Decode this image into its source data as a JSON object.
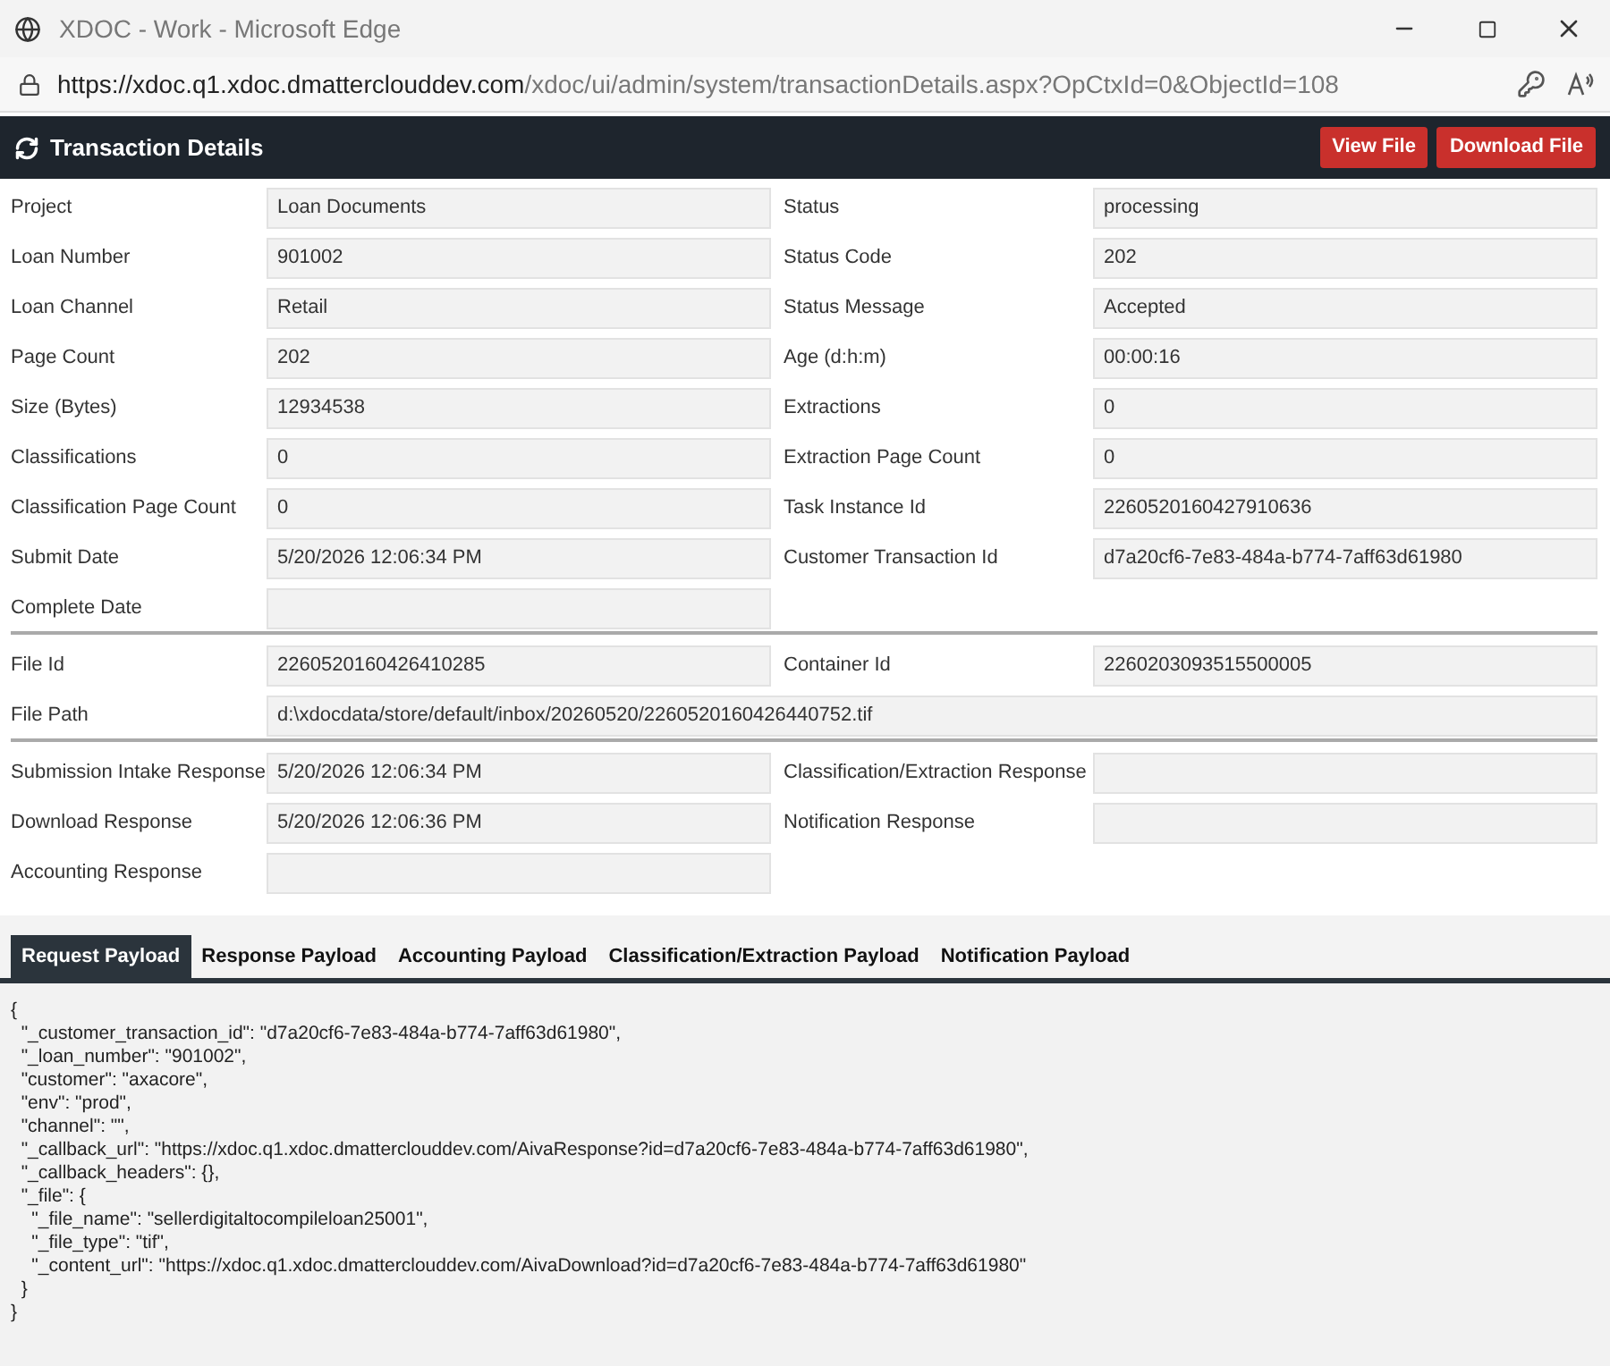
{
  "window": {
    "title": "XDOC - Work - Microsoft Edge"
  },
  "address_bar": {
    "url_host": "https://xdoc.q1.xdoc.dmatterclouddev.com",
    "url_path": "/xdoc/ui/admin/system/transactionDetails.aspx?OpCtxId=0&ObjectId=108"
  },
  "header": {
    "title": "Transaction Details",
    "buttons": [
      "View File",
      "Download File"
    ]
  },
  "sections": [
    {
      "rows": [
        {
          "kind": "pair",
          "cells": [
            {
              "label": "Project",
              "value": "Loan Documents"
            },
            {
              "label": "Status",
              "value": "processing"
            }
          ]
        },
        {
          "kind": "pair",
          "cells": [
            {
              "label": "Loan Number",
              "value": "901002"
            },
            {
              "label": "Status Code",
              "value": "202"
            }
          ]
        },
        {
          "kind": "pair",
          "cells": [
            {
              "label": "Loan Channel",
              "value": "Retail"
            },
            {
              "label": "Status Message",
              "value": "Accepted"
            }
          ]
        },
        {
          "kind": "pair",
          "cells": [
            {
              "label": "Page Count",
              "value": "202"
            },
            {
              "label": "Age (d:h:m)",
              "value": "00:00:16"
            }
          ]
        },
        {
          "kind": "pair",
          "cells": [
            {
              "label": "Size (Bytes)",
              "value": "12934538"
            },
            {
              "label": "Extractions",
              "value": "0"
            }
          ]
        },
        {
          "kind": "pair",
          "cells": [
            {
              "label": "Classifications",
              "value": "0"
            },
            {
              "label": "Extraction Page Count",
              "value": "0"
            }
          ]
        },
        {
          "kind": "pair",
          "cells": [
            {
              "label": "Classification Page Count",
              "value": "0"
            },
            {
              "label": "Task Instance Id",
              "value": "2260520160427910636"
            }
          ]
        },
        {
          "kind": "pair",
          "cells": [
            {
              "label": "Submit Date",
              "value": "5/20/2026 12:06:34 PM"
            },
            {
              "label": "Customer Transaction Id",
              "value": "d7a20cf6-7e83-484a-b774-7aff63d61980"
            }
          ]
        },
        {
          "kind": "pair",
          "cells": [
            {
              "label": "Complete Date"
            }
          ]
        }
      ]
    },
    {
      "rows": [
        {
          "kind": "pair",
          "cells": [
            {
              "label": "File Id",
              "value": "2260520160426410285"
            },
            {
              "label": "Container Id",
              "value": "2260203093515500005"
            }
          ]
        },
        {
          "kind": "wide",
          "cells": [
            {
              "label": "File Path",
              "value": "d:\\xdocdata/store/default/inbox/20260520/2260520160426440752.tif"
            }
          ]
        }
      ]
    },
    {
      "rows": [
        {
          "kind": "pair",
          "cells": [
            {
              "label": "Submission Intake Response",
              "value": "5/20/2026 12:06:34 PM"
            },
            {
              "label": "Classification/Extraction Response"
            }
          ]
        },
        {
          "kind": "pair",
          "cells": [
            {
              "label": "Download Response",
              "value": "5/20/2026 12:06:36 PM"
            },
            {
              "label": "Notification Response"
            }
          ]
        },
        {
          "kind": "pair",
          "cells": [
            {
              "label": "Accounting Response"
            }
          ]
        }
      ]
    }
  ],
  "tabs": [
    {
      "label": "Request Payload",
      "selected": true
    },
    {
      "label": "Response Payload",
      "selected": false
    },
    {
      "label": "Accounting Payload",
      "selected": false
    },
    {
      "label": "Classification/Extraction Payload",
      "selected": false
    },
    {
      "label": "Notification Payload",
      "selected": false
    }
  ],
  "payload": [
    "{",
    "  \"_customer_transaction_id\": \"d7a20cf6-7e83-484a-b774-7aff63d61980\",",
    "  \"_loan_number\": \"901002\",",
    "  \"customer\": \"axacore\",",
    "  \"env\": \"prod\",",
    "  \"channel\": \"\",",
    "  \"_callback_url\": \"https://xdoc.q1.xdoc.dmatterclouddev.com/AivaResponse?id=d7a20cf6-7e83-484a-b774-7aff63d61980\",",
    "  \"_callback_headers\": {},",
    "  \"_file\": {",
    "    \"_file_name\": \"sellerdigitaltocompileloan25001\",",
    "    \"_file_type\": \"tif\",",
    "    \"_content_url\": \"https://xdoc.q1.xdoc.dmatterclouddev.com/AivaDownload?id=d7a20cf6-7e83-484a-b774-7aff63d61980\"",
    "  }",
    "}"
  ]
}
